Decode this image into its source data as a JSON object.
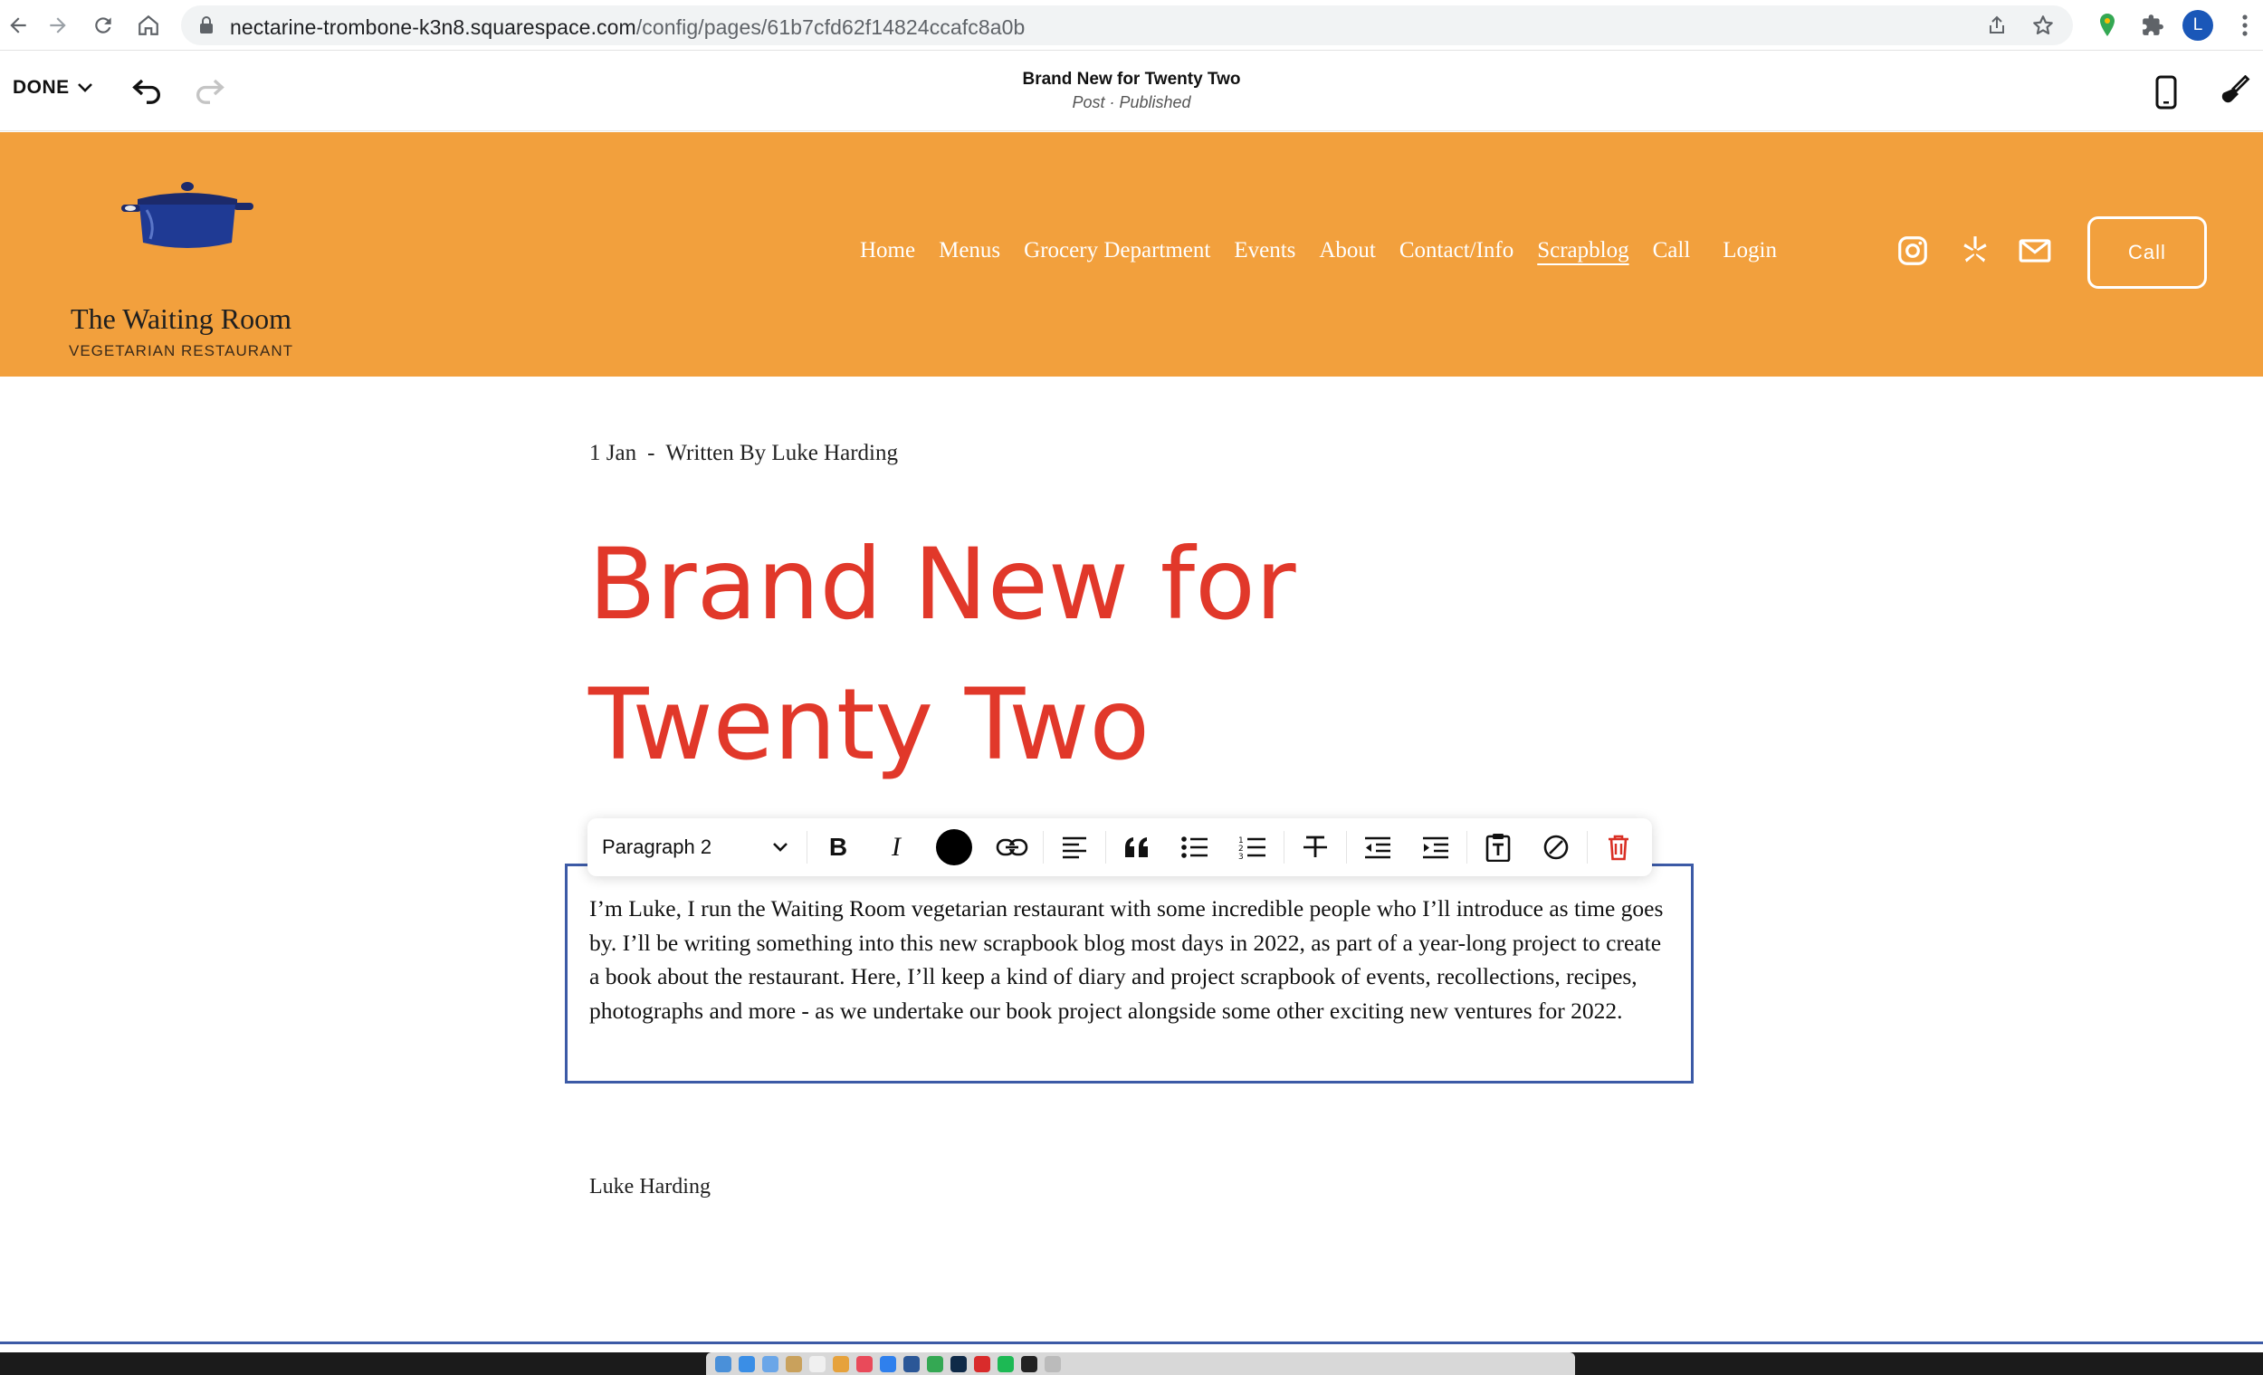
{
  "browser": {
    "url_host": "nectarine-trombone-k3n8.squarespace.com",
    "url_path": "/config/pages/61b7cfd62f14824ccafc8a0b",
    "profile_initial": "L"
  },
  "editor": {
    "done_label": "DONE",
    "page_title": "Brand New for Twenty Two",
    "page_status": "Post · Published"
  },
  "site": {
    "logo_name": "The Waiting Room",
    "logo_sub": "VEGETARIAN RESTAURANT",
    "nav": [
      "Home",
      "Menus",
      "Grocery Department",
      "Events",
      "About",
      "Contact/Info",
      "Scrapblog",
      "Call",
      "Login"
    ],
    "active_nav": "Scrapblog",
    "cta_label": "Call",
    "header_color": "#f2a03d"
  },
  "post": {
    "date": "1 Jan",
    "separator": "-",
    "byline": "Written By Luke Harding",
    "title_line1": "Brand New for",
    "title_line2": "Twenty Two",
    "title_color": "#e1382a",
    "body": "I’m Luke, I run the Waiting Room vegetarian restaurant with some incredible people who I’ll introduce as time goes by. I’ll be writing something into this new scrapbook blog most days in 2022, as part of a year-long project to create a book about the restaurant. Here, I’ll keep a kind of diary and project scrapbook of events, recollections, recipes, photographs and more - as we undertake our book project alongside some other exciting new ventures for 2022.",
    "author": "Luke Harding"
  },
  "toolbar": {
    "style_select": "Paragraph 2",
    "bold_glyph": "B",
    "italic_glyph": "I",
    "text_color": "#000000",
    "delete_color": "#d93025"
  },
  "icons": [
    "back-icon",
    "forward-icon",
    "reload-icon",
    "home-icon",
    "lock-icon",
    "share-icon",
    "star-icon",
    "maps-extension-icon",
    "puzzle-icon",
    "more-vert-icon",
    "chevron-down-icon",
    "undo-icon",
    "redo-icon",
    "mobile-icon",
    "paintbrush-icon",
    "instagram-icon",
    "yelp-icon",
    "email-icon",
    "link-icon",
    "align-left-icon",
    "quote-icon",
    "bullet-list-icon",
    "numbered-list-icon",
    "strikethrough-icon",
    "outdent-icon",
    "indent-icon",
    "paste-text-icon",
    "clear-format-icon",
    "trash-icon"
  ]
}
